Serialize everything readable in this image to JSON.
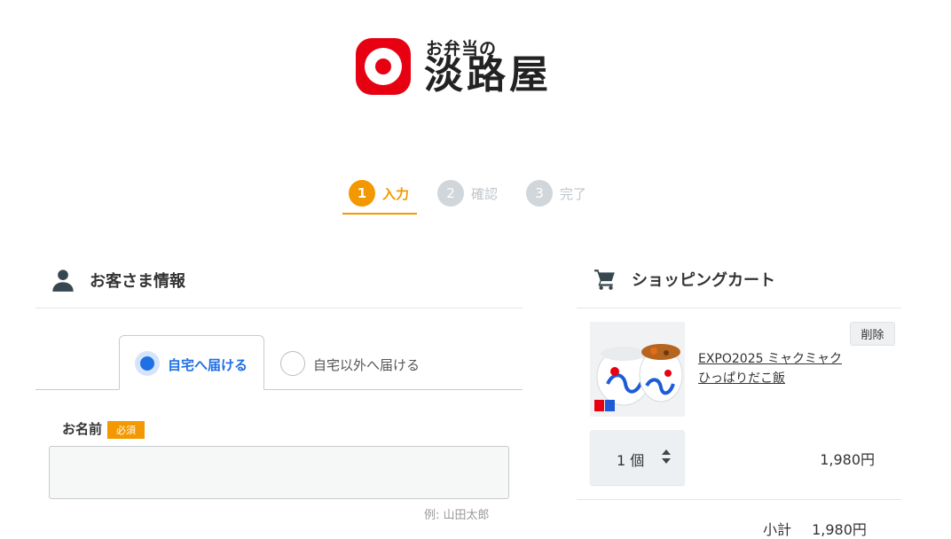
{
  "logo": {
    "small_text": "お弁当の",
    "big_text": "淡路屋"
  },
  "steps": [
    {
      "num": "1",
      "label": "入力"
    },
    {
      "num": "2",
      "label": "確認"
    },
    {
      "num": "3",
      "label": "完了"
    }
  ],
  "customer": {
    "title": "お客さま情報",
    "tabs": [
      {
        "label": "自宅へ届ける"
      },
      {
        "label": "自宅以外へ届ける"
      }
    ],
    "name_label": "お名前",
    "required_badge": "必須",
    "name_value": "",
    "name_hint": "例: 山田太郎"
  },
  "cart": {
    "title": "ショッピングカート",
    "delete_label": "削除",
    "item_name": "EXPO2025 ミャクミャク ひっぱりだこ飯",
    "quantity": "1 個",
    "price": "1,980円",
    "subtotal_label": "小計",
    "subtotal_value": "1,980円"
  }
}
